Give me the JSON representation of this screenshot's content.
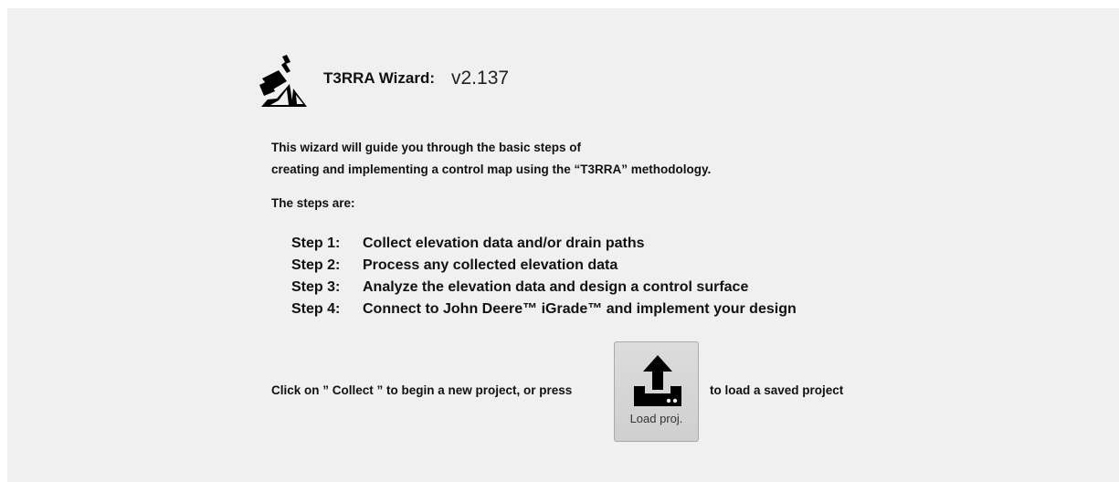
{
  "header": {
    "app_name": "T3RRA Wizard:",
    "version": "v2.137",
    "logo_icon": "tractor-blade-logo-icon"
  },
  "intro": {
    "line1": "This wizard will guide you through the basic steps of",
    "line2": "creating and implementing a control map using the “T3RRA” methodology."
  },
  "steps_heading": "The steps are:",
  "steps": [
    {
      "number": "Step 1:",
      "text": "Collect elevation data and/or drain paths"
    },
    {
      "number": "Step 2:",
      "text": "Process any collected elevation data"
    },
    {
      "number": "Step 3:",
      "text": "Analyze the elevation data and design a control surface"
    },
    {
      "number": "Step 4:",
      "text": "Connect to John Deere™ iGrade™ and implement your design"
    }
  ],
  "footer": {
    "before_button": "Click on ” Collect ” to begin a new project, or press",
    "after_button": "to load a saved project"
  },
  "load_button": {
    "label": "Load proj.",
    "icon": "upload-icon"
  },
  "colors": {
    "background": "#f0f0f0",
    "text": "#111111",
    "button_face": "#d6d6d6"
  }
}
